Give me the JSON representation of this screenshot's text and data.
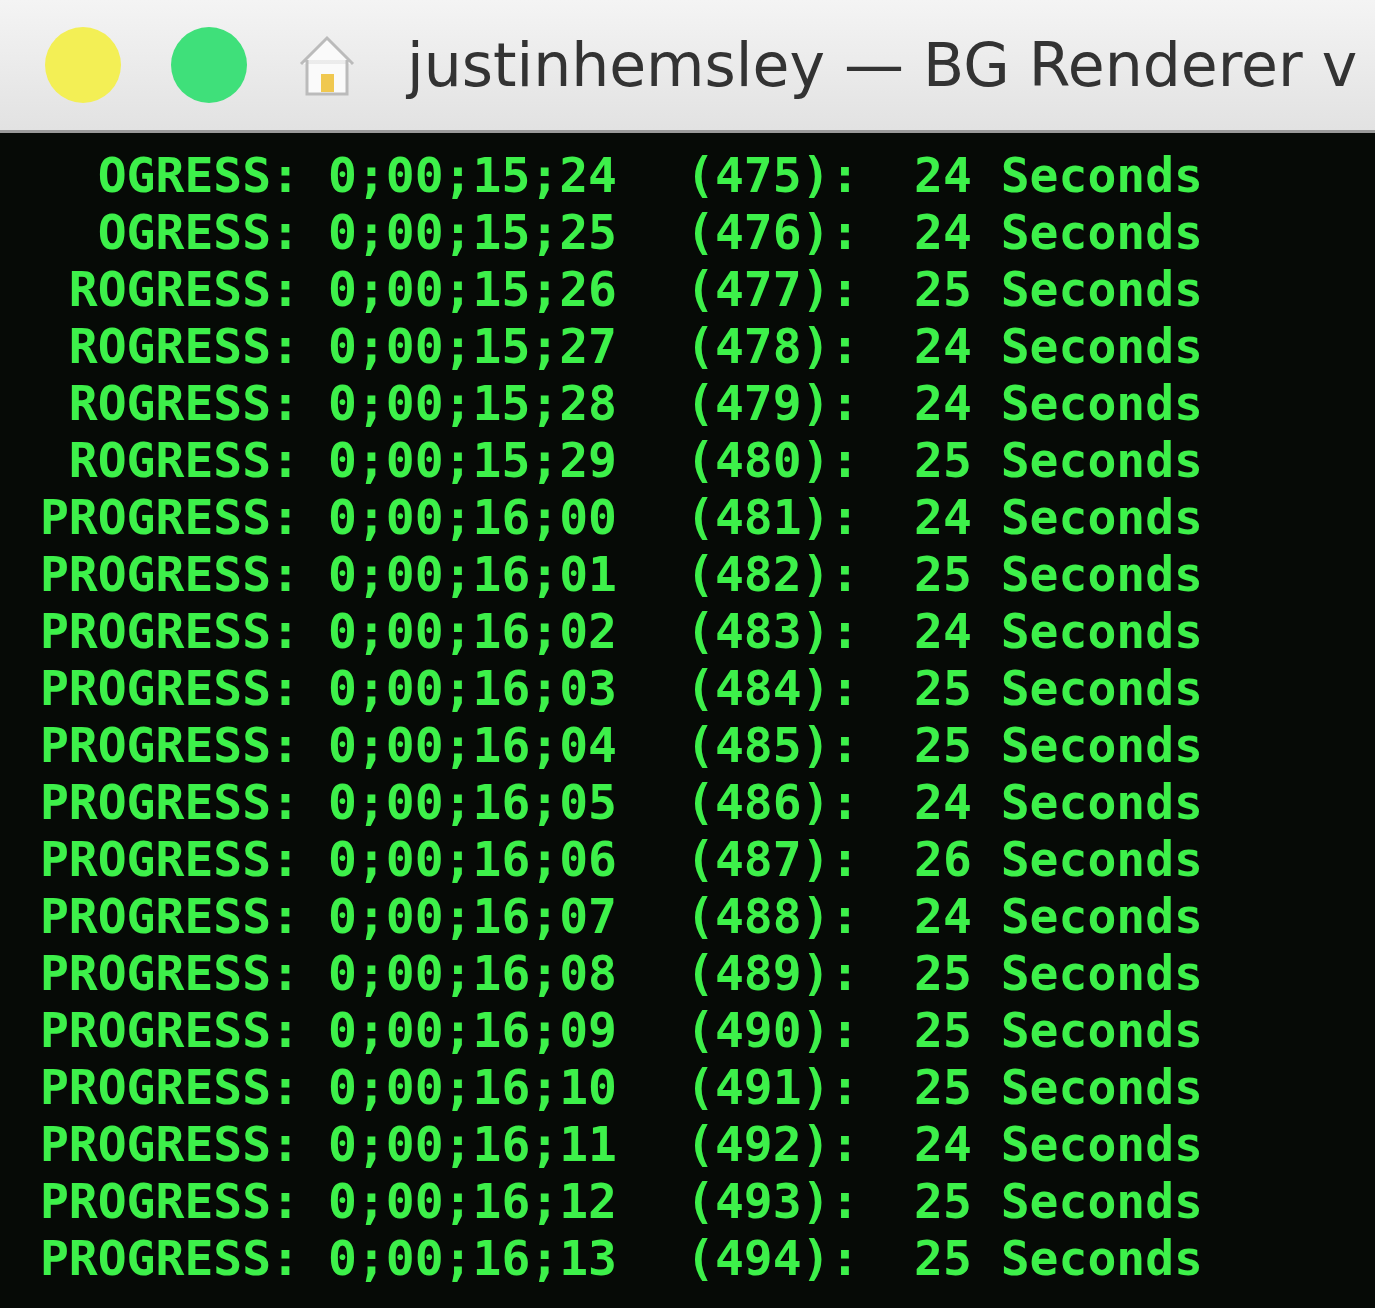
{
  "window": {
    "title": "justinhemsley — BG Renderer v"
  },
  "rows": [
    {
      "label": "OGRESS:",
      "timecode": "0;00;15;24",
      "frame": "(475):",
      "duration": "24 Seconds"
    },
    {
      "label": "OGRESS:",
      "timecode": "0;00;15;25",
      "frame": "(476):",
      "duration": "24 Seconds"
    },
    {
      "label": "ROGRESS:",
      "timecode": "0;00;15;26",
      "frame": "(477):",
      "duration": "25 Seconds"
    },
    {
      "label": "ROGRESS:",
      "timecode": "0;00;15;27",
      "frame": "(478):",
      "duration": "24 Seconds"
    },
    {
      "label": "ROGRESS:",
      "timecode": "0;00;15;28",
      "frame": "(479):",
      "duration": "24 Seconds"
    },
    {
      "label": "ROGRESS:",
      "timecode": "0;00;15;29",
      "frame": "(480):",
      "duration": "25 Seconds"
    },
    {
      "label": "PROGRESS:",
      "timecode": "0;00;16;00",
      "frame": "(481):",
      "duration": "24 Seconds"
    },
    {
      "label": "PROGRESS:",
      "timecode": "0;00;16;01",
      "frame": "(482):",
      "duration": "25 Seconds"
    },
    {
      "label": "PROGRESS:",
      "timecode": "0;00;16;02",
      "frame": "(483):",
      "duration": "24 Seconds"
    },
    {
      "label": "PROGRESS:",
      "timecode": "0;00;16;03",
      "frame": "(484):",
      "duration": "25 Seconds"
    },
    {
      "label": "PROGRESS:",
      "timecode": "0;00;16;04",
      "frame": "(485):",
      "duration": "25 Seconds"
    },
    {
      "label": "PROGRESS:",
      "timecode": "0;00;16;05",
      "frame": "(486):",
      "duration": "24 Seconds"
    },
    {
      "label": "PROGRESS:",
      "timecode": "0;00;16;06",
      "frame": "(487):",
      "duration": "26 Seconds"
    },
    {
      "label": "PROGRESS:",
      "timecode": "0;00;16;07",
      "frame": "(488):",
      "duration": "24 Seconds"
    },
    {
      "label": "PROGRESS:",
      "timecode": "0;00;16;08",
      "frame": "(489):",
      "duration": "25 Seconds"
    },
    {
      "label": "PROGRESS:",
      "timecode": "0;00;16;09",
      "frame": "(490):",
      "duration": "25 Seconds"
    },
    {
      "label": "PROGRESS:",
      "timecode": "0;00;16;10",
      "frame": "(491):",
      "duration": "25 Seconds"
    },
    {
      "label": "PROGRESS:",
      "timecode": "0;00;16;11",
      "frame": "(492):",
      "duration": "24 Seconds"
    },
    {
      "label": "PROGRESS:",
      "timecode": "0;00;16;12",
      "frame": "(493):",
      "duration": "25 Seconds"
    },
    {
      "label": "PROGRESS:",
      "timecode": "0;00;16;13",
      "frame": "(494):",
      "duration": "25 Seconds"
    }
  ]
}
